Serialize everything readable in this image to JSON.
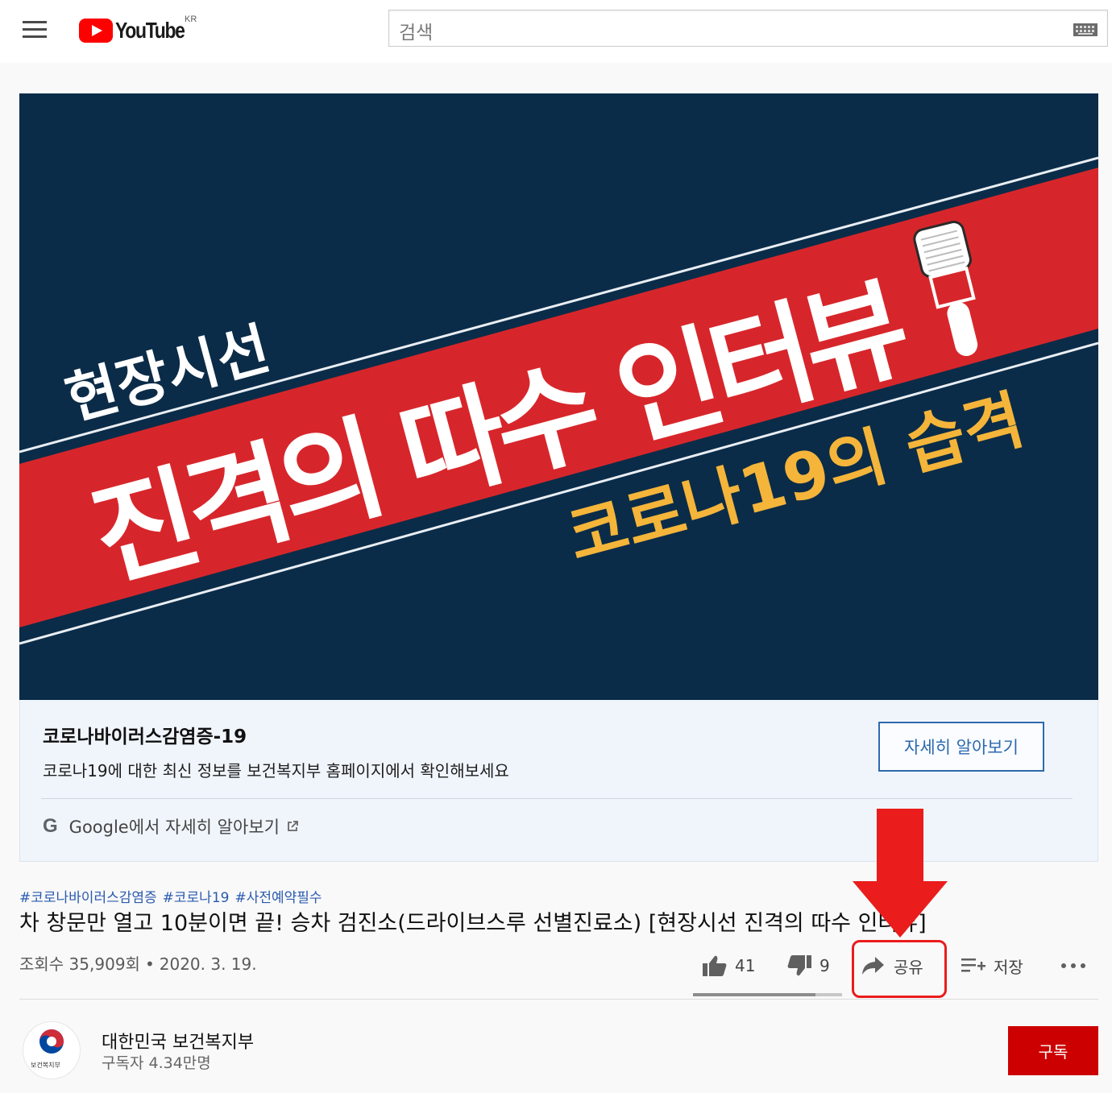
{
  "header": {
    "logo_text": "YouTube",
    "region": "KR",
    "search_placeholder": "검색"
  },
  "thumbnail": {
    "kicker": "현장시선",
    "headline": "진격의 따수 인터뷰",
    "subheadline": "코로나19의 습격",
    "colors": {
      "background": "#0b2c48",
      "band": "#d7262b",
      "accent": "#f4b53a"
    }
  },
  "info_panel": {
    "title": "코로나바이러스감염증-19",
    "description": "코로나19에 대한 최신 정보를 보건복지부 홈페이지에서 확인해보세요",
    "button_label": "자세히 알아보기",
    "google_letter": "G",
    "google_link": "Google에서 자세히 알아보기"
  },
  "video": {
    "hashtags": [
      "#코로나바이러스감염증",
      "#코로나19",
      "#사전예약필수"
    ],
    "title": "차 창문만 열고 10분이면 끝! 승차 검진소(드라이브스루 선별진료소) [현장시선 진격의 따수 인터뷰]",
    "views": "조회수 35,909회",
    "separator": "•",
    "date": "2020. 3. 19.",
    "likes": "41",
    "dislikes": "9",
    "like_ratio": 0.82,
    "share_label": "공유",
    "save_label": "저장"
  },
  "channel": {
    "name": "대한민국 보건복지부",
    "subscribers": "구독자 4.34만명",
    "avatar_caption": "보건복지부",
    "subscribe_label": "구독"
  },
  "annotation": {
    "color": "#ea1c1c",
    "target": "share-button"
  }
}
